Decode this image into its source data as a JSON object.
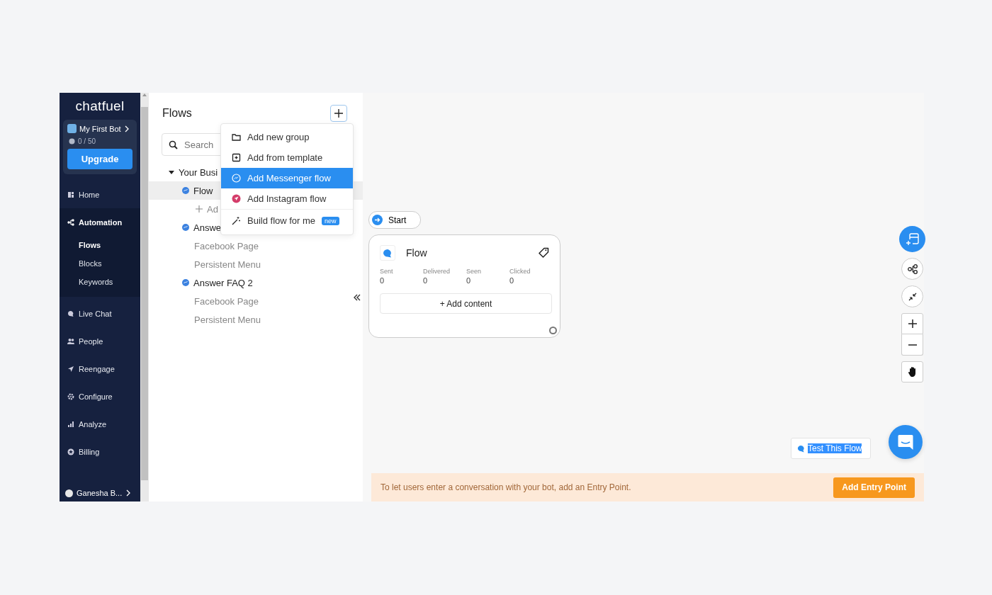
{
  "sidebar": {
    "logo": "chatfuel",
    "bot": {
      "name": "My First Bot",
      "usage": "0 / 50"
    },
    "upgrade": "Upgrade",
    "nav": [
      {
        "label": "Home",
        "selected": false
      },
      {
        "label": "Automation",
        "selected": true,
        "children": [
          {
            "label": "Flows",
            "selected": true
          },
          {
            "label": "Blocks",
            "selected": false
          },
          {
            "label": "Keywords",
            "selected": false
          }
        ]
      },
      {
        "label": "Live Chat",
        "selected": false
      },
      {
        "label": "People",
        "selected": false
      },
      {
        "label": "Reengage",
        "selected": false
      },
      {
        "label": "Configure",
        "selected": false
      },
      {
        "label": "Analyze",
        "selected": false
      },
      {
        "label": "Billing",
        "selected": false
      }
    ],
    "user": "Ganesha B..."
  },
  "flows_panel": {
    "title": "Flows",
    "search": {
      "placeholder": "Search"
    },
    "tree": [
      {
        "label": "Your Busi",
        "kind": "group",
        "expanded": true,
        "children": [
          {
            "label": "Flow",
            "kind": "flow",
            "selected": true
          },
          {
            "label": "Ad",
            "kind": "add",
            "selected": false
          },
          {
            "label": "Answe",
            "kind": "flow",
            "selected": false,
            "children": [
              {
                "label": "Facebook Page",
                "kind": "entry",
                "selected": false
              },
              {
                "label": "Persistent Menu",
                "kind": "entry",
                "selected": false
              }
            ]
          },
          {
            "label": "Answer FAQ 2",
            "kind": "flow",
            "selected": false,
            "children": [
              {
                "label": "Facebook Page",
                "kind": "entry",
                "selected": false
              },
              {
                "label": "Persistent Menu",
                "kind": "entry",
                "selected": false
              }
            ]
          }
        ]
      }
    ],
    "menu": [
      {
        "label": "Add new group",
        "kind": "folder",
        "selected": false
      },
      {
        "label": "Add from template",
        "kind": "template",
        "selected": false
      },
      {
        "label": "Add Messenger flow",
        "kind": "messenger",
        "selected": true
      },
      {
        "label": "Add Instagram flow",
        "kind": "instagram",
        "selected": false
      },
      {
        "label": "Build flow for me",
        "kind": "magic",
        "selected": false,
        "badge": "new"
      }
    ]
  },
  "canvas": {
    "start": "Start",
    "card": {
      "title": "Flow",
      "stats": [
        {
          "label": "Sent",
          "value": "0"
        },
        {
          "label": "Delivered",
          "value": "0"
        },
        {
          "label": "Seen",
          "value": "0"
        },
        {
          "label": "Clicked",
          "value": "0"
        }
      ],
      "add_content": "+ Add content"
    },
    "test_flow": {
      "label": "Test This Flow",
      "text_selected": true
    },
    "banner": {
      "text": "To let users enter a conversation with your bot, add an Entry Point.",
      "button": "Add Entry Point"
    }
  }
}
